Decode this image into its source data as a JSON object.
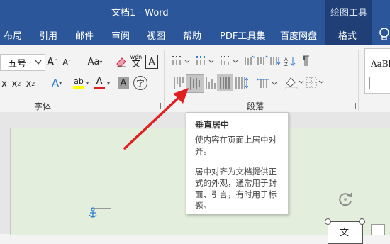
{
  "window": {
    "title": "文档1  -  Word",
    "context_tab_group": "绘图工具"
  },
  "tabs": [
    {
      "label": "布局"
    },
    {
      "label": "引用"
    },
    {
      "label": "邮件"
    },
    {
      "label": "审阅"
    },
    {
      "label": "视图"
    },
    {
      "label": "帮助"
    },
    {
      "label": "PDF工具集"
    },
    {
      "label": "百度网盘"
    },
    {
      "label": "格式"
    }
  ],
  "font_group": {
    "label": "字体",
    "font_size": "五号",
    "grow_label": "A",
    "shrink_label": "A",
    "case_label": "Aa",
    "phonetic_label": "wén",
    "phonetic_char": "文",
    "border_char": "A",
    "strike_label": "x",
    "subscript_label": "x",
    "superscript_label": "x",
    "subscript_mark": "2",
    "superscript_mark": "2",
    "effects_label": "A",
    "highlight_label": "ab",
    "fontcolor_label": "A",
    "shading_label": "A",
    "enclose_char": "字"
  },
  "paragraph_group": {
    "label": "段落"
  },
  "styles_group": {
    "preview": "AaBb"
  },
  "tooltip": {
    "title": "垂直居中",
    "line1": "使内容在页面上居中对齐。",
    "line2": "居中对齐为文档提供正式的外观，通常用于封面、引言，有时用于标题。"
  },
  "textbox_char": "文",
  "colors": {
    "title_bar": "#2b579a",
    "context_band": "#1f3f76",
    "arrow": "#e02020",
    "highlight": "#ffff00",
    "font_color": "#e02020",
    "page": "#e3efdc"
  }
}
